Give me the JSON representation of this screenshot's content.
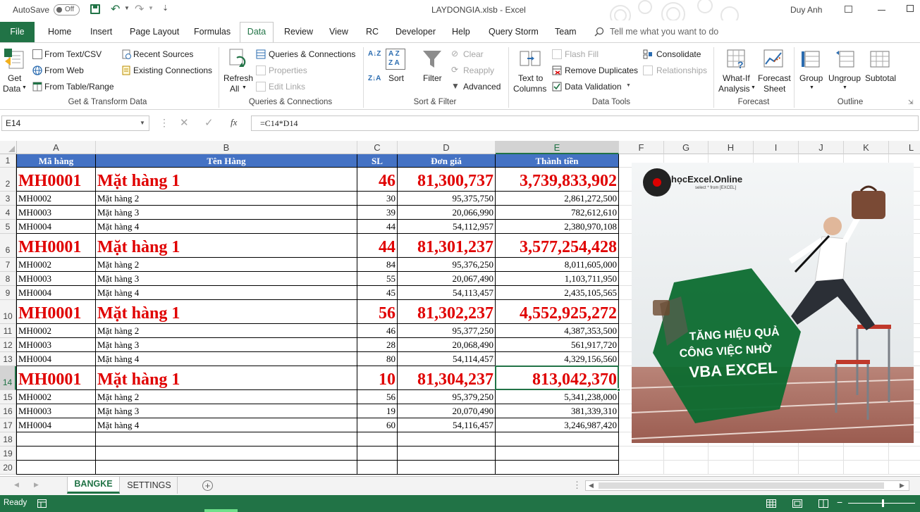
{
  "titlebar": {
    "autosave_label": "AutoSave",
    "autosave_state": "Off",
    "document_title": "LAYDONGIA.xlsb  -  Excel",
    "user_name": "Duy Anh"
  },
  "tabs": [
    "File",
    "Home",
    "Insert",
    "Page Layout",
    "Formulas",
    "Data",
    "Review",
    "View",
    "RC",
    "Developer",
    "Help",
    "Query Storm",
    "Team"
  ],
  "tell_me": "Tell me what you want to do",
  "ribbon": {
    "get_data": [
      "Get",
      "Data"
    ],
    "from_text": "From Text/CSV",
    "from_web": "From Web",
    "from_table": "From Table/Range",
    "recent_sources": "Recent Sources",
    "existing_connections": "Existing Connections",
    "group_get": "Get & Transform Data",
    "refresh": [
      "Refresh",
      "All"
    ],
    "queries": "Queries & Connections",
    "properties": "Properties",
    "edit_links": "Edit Links",
    "group_queries": "Queries & Connections",
    "sort": "Sort",
    "filter": "Filter",
    "clear": "Clear",
    "reapply": "Reapply",
    "advanced": "Advanced",
    "group_sort": "Sort & Filter",
    "text_to_columns": [
      "Text to",
      "Columns"
    ],
    "flash_fill": "Flash Fill",
    "remove_duplicates": "Remove Duplicates",
    "data_validation": "Data Validation",
    "consolidate": "Consolidate",
    "relationships": "Relationships",
    "group_tools": "Data Tools",
    "whatif": [
      "What-If",
      "Analysis"
    ],
    "forecast_sheet": [
      "Forecast",
      "Sheet"
    ],
    "group_forecast": "Forecast",
    "group": "Group",
    "ungroup": "Ungroup",
    "subtotal": "Subtotal",
    "group_outline": "Outline"
  },
  "formula_bar": {
    "name_box": "E14",
    "formula": "=C14*D14",
    "fx": "fx"
  },
  "columns": [
    "A",
    "B",
    "C",
    "D",
    "E",
    "F",
    "G",
    "H",
    "I",
    "J",
    "K",
    "L"
  ],
  "rows": [
    "1",
    "2",
    "3",
    "4",
    "5",
    "6",
    "7",
    "8",
    "9",
    "10",
    "11",
    "12",
    "13",
    "14",
    "15",
    "16",
    "17",
    "18",
    "19",
    "20"
  ],
  "headers": [
    "Mã hàng",
    "Tên Hàng",
    "SL",
    "Đơn giá",
    "Thành tiền"
  ],
  "table": [
    [
      "MH0001",
      "Mặt hàng 1",
      "46",
      "81,300,737",
      "3,739,833,902"
    ],
    [
      "MH0002",
      "Mặt hàng 2",
      "30",
      "95,375,750",
      "2,861,272,500"
    ],
    [
      "MH0003",
      "Mặt hàng 3",
      "39",
      "20,066,990",
      "782,612,610"
    ],
    [
      "MH0004",
      "Mặt hàng 4",
      "44",
      "54,112,957",
      "2,380,970,108"
    ],
    [
      "MH0001",
      "Mặt hàng 1",
      "44",
      "81,301,237",
      "3,577,254,428"
    ],
    [
      "MH0002",
      "Mặt hàng 2",
      "84",
      "95,376,250",
      "8,011,605,000"
    ],
    [
      "MH0003",
      "Mặt hàng 3",
      "55",
      "20,067,490",
      "1,103,711,950"
    ],
    [
      "MH0004",
      "Mặt hàng 4",
      "45",
      "54,113,457",
      "2,435,105,565"
    ],
    [
      "MH0001",
      "Mặt hàng 1",
      "56",
      "81,302,237",
      "4,552,925,272"
    ],
    [
      "MH0002",
      "Mặt hàng 2",
      "46",
      "95,377,250",
      "4,387,353,500"
    ],
    [
      "MH0003",
      "Mặt hàng 3",
      "28",
      "20,068,490",
      "561,917,720"
    ],
    [
      "MH0004",
      "Mặt hàng 4",
      "80",
      "54,114,457",
      "4,329,156,560"
    ],
    [
      "MH0001",
      "Mặt hàng 1",
      "10",
      "81,304,237",
      "813,042,370"
    ],
    [
      "MH0002",
      "Mặt hàng 2",
      "56",
      "95,379,250",
      "5,341,238,000"
    ],
    [
      "MH0003",
      "Mặt hàng 3",
      "19",
      "20,070,490",
      "381,339,310"
    ],
    [
      "MH0004",
      "Mặt hàng 4",
      "60",
      "54,116,457",
      "3,246,987,420"
    ]
  ],
  "banner": {
    "logo_text": "họcExcel.Online",
    "logo_sub": "select * from [EXCEL]",
    "line1": "TĂNG HIỆU QUẢ",
    "line2": "CÔNG VIỆC NHỜ",
    "line3": "VBA EXCEL"
  },
  "sheets": [
    "BANGKE",
    "SETTINGS"
  ],
  "status": {
    "ready": "Ready"
  },
  "colors": {
    "excel_green": "#217346",
    "header_blue": "#4472c4",
    "emphasis_red": "#e00000"
  }
}
